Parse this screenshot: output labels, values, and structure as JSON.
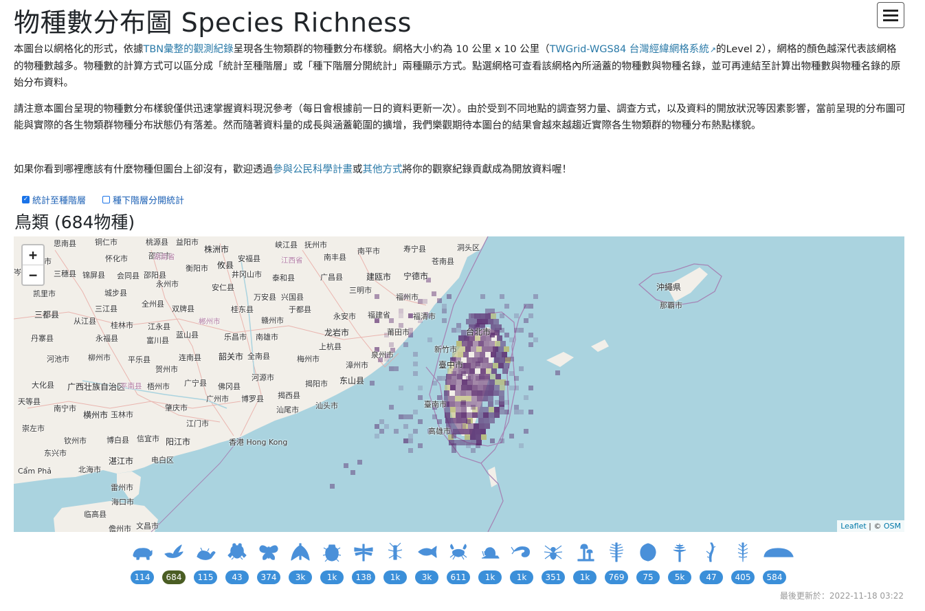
{
  "header": {
    "title": "物種數分布圖 Species Richness",
    "menu_icon": "hamburger-icon"
  },
  "intro": {
    "p1": {
      "t1": "本圖台以網格化的形式，依據",
      "link1": "TBN彙整的觀測紀錄",
      "t2": "呈現各生物類群的物種數分布樣貌。網格大小約為 10 公里 x 10 公里（",
      "link2": "TWGrid-WGS84 台灣經緯網格系統",
      "t3": "的Level 2），網格的顏色越深代表該網格的物種數越多。物種數的計算方式可以區分成「統計至種階層」或「種下階層分開統計」兩種顯示方式。點選網格可查看該網格內所涵蓋的物種數與物種名錄，並可再連結至計算出物種數與物種名錄的原始分布資料。"
    },
    "p2": "請注意本圖台呈現的物種數分布樣貌僅供迅速掌握資料現況參考（每日會根據前一日的資料更新一次）。由於受到不同地點的調查努力量、調查方式，以及資料的開放狀況等因素影響，當前呈現的分布圖可能與實際的各生物類群物種分布狀態仍有落差。然而隨著資料量的成長與涵蓋範圍的擴增，我們樂觀期待本圖台的結果會越來越趨近實際各生物類群的物種分布熱點樣貌。",
    "p3": {
      "t1": "如果你看到哪裡應該有什麼物種但圖台上卻沒有，歡迎透過",
      "link1": "參與公民科學計畫",
      "t2": "或",
      "link2": "其他方式",
      "t3": "將你的觀察紀錄貢獻成為開放資料喔！"
    }
  },
  "toggles": [
    {
      "label": "統計至種階層",
      "checked": true
    },
    {
      "label": "種下階層分開統計",
      "checked": false
    }
  ],
  "group_heading": "鳥類 (684物種)",
  "map": {
    "zoom_in": "+",
    "zoom_out": "−",
    "attribution": {
      "leaflet": "Leaflet",
      "sep": " | © ",
      "osm": "OSM"
    },
    "labels": [
      "思南县",
      "铜仁市",
      "桃源县",
      "益阳市",
      "株洲市",
      "峡江县",
      "抚州市",
      "南平市",
      "寿宁县",
      "洞头区",
      "凯里市",
      "怀化市",
      "邵阳市",
      "湖南省",
      "衡阳市",
      "攸县",
      "安福县",
      "江西省",
      "南丰县",
      "苍南县",
      "岑巩县",
      "三穗县",
      "锦屏县",
      "会同县",
      "邵阳县",
      "永州市",
      "安仁县",
      "井冈山市",
      "泰和县",
      "广昌县",
      "建瓯市",
      "宁德市",
      "凯里市",
      "城步县",
      "全州县",
      "双牌县",
      "桂东县",
      "万安县",
      "兴国县",
      "三明市",
      "福州市",
      "三都县",
      "三江县",
      "桂林市",
      "江永县",
      "郴州市",
      "赣州市",
      "于都县",
      "永安市",
      "福建省",
      "福清市",
      "从江县",
      "蓝山县",
      "乐昌市",
      "南雄市",
      "龙岩市",
      "莆田市",
      "台北市",
      "沖繩県",
      "那覇市",
      "丹寨县",
      "永福县",
      "富川县",
      "上杭县",
      "新竹市",
      "泉州市",
      "河池市",
      "柳州市",
      "平乐县",
      "连南县",
      "韶关市",
      "全南县",
      "梅州市",
      "漳州市",
      "臺中市",
      "大化县",
      "广西壮族自治区",
      "平南县",
      "梧州市",
      "贺州市",
      "广宁县",
      "佛冈县",
      "河源市",
      "揭阳市",
      "东山县",
      "天等县",
      "广州市",
      "博罗县",
      "揭西县",
      "汕头市",
      "臺南市",
      "南宁市",
      "横州市",
      "玉林市",
      "肇庆市",
      "江门市",
      "汕尾市",
      "高雄市",
      "崇左市",
      "钦州市",
      "博白县",
      "信宜市",
      "阳江市",
      "香港 Hong Kong",
      "东兴市",
      "湛江市",
      "电白区",
      "北海市",
      "Cẩm Phả",
      "雷州市",
      "海口市",
      "临高县",
      "儋州市",
      "文昌市"
    ]
  },
  "groups": [
    {
      "icon": "mammal-icon",
      "count": "114",
      "active": false
    },
    {
      "icon": "bird-icon",
      "count": "684",
      "active": true
    },
    {
      "icon": "reptile-icon",
      "count": "115",
      "active": false
    },
    {
      "icon": "amphibian-icon",
      "count": "43",
      "active": false
    },
    {
      "icon": "butterfly-icon",
      "count": "374",
      "active": false
    },
    {
      "icon": "moth-icon",
      "count": "3k",
      "active": false
    },
    {
      "icon": "beetle-icon",
      "count": "1k",
      "active": false
    },
    {
      "icon": "dragonfly-icon",
      "count": "138",
      "active": false
    },
    {
      "icon": "insect-icon",
      "count": "1k",
      "active": false
    },
    {
      "icon": "fish-icon",
      "count": "3k",
      "active": false
    },
    {
      "icon": "crab-icon",
      "count": "611",
      "active": false
    },
    {
      "icon": "snail-icon",
      "count": "1k",
      "active": false
    },
    {
      "icon": "shrimp-icon",
      "count": "1k",
      "active": false
    },
    {
      "icon": "spider-icon",
      "count": "351",
      "active": false
    },
    {
      "icon": "mushroom-icon",
      "count": "1k",
      "active": false
    },
    {
      "icon": "fern-icon",
      "count": "769",
      "active": false
    },
    {
      "icon": "leaf-icon",
      "count": "75",
      "active": false
    },
    {
      "icon": "flower-icon",
      "count": "5k",
      "active": false
    },
    {
      "icon": "seaweed-icon",
      "count": "47",
      "active": false
    },
    {
      "icon": "grass-icon",
      "count": "405",
      "active": false
    },
    {
      "icon": "coral-icon",
      "count": "584",
      "active": false
    }
  ],
  "updated": "最後更新於：2022-11-18 03:22",
  "colors": {
    "link": "#2a7aa8",
    "badge": "#3b8fd9",
    "badge_active": "#4a5d23",
    "icon": "#4a90d9",
    "sea": "#aad3df",
    "land": "#f2efe9",
    "grid": "#5a2a6e"
  }
}
